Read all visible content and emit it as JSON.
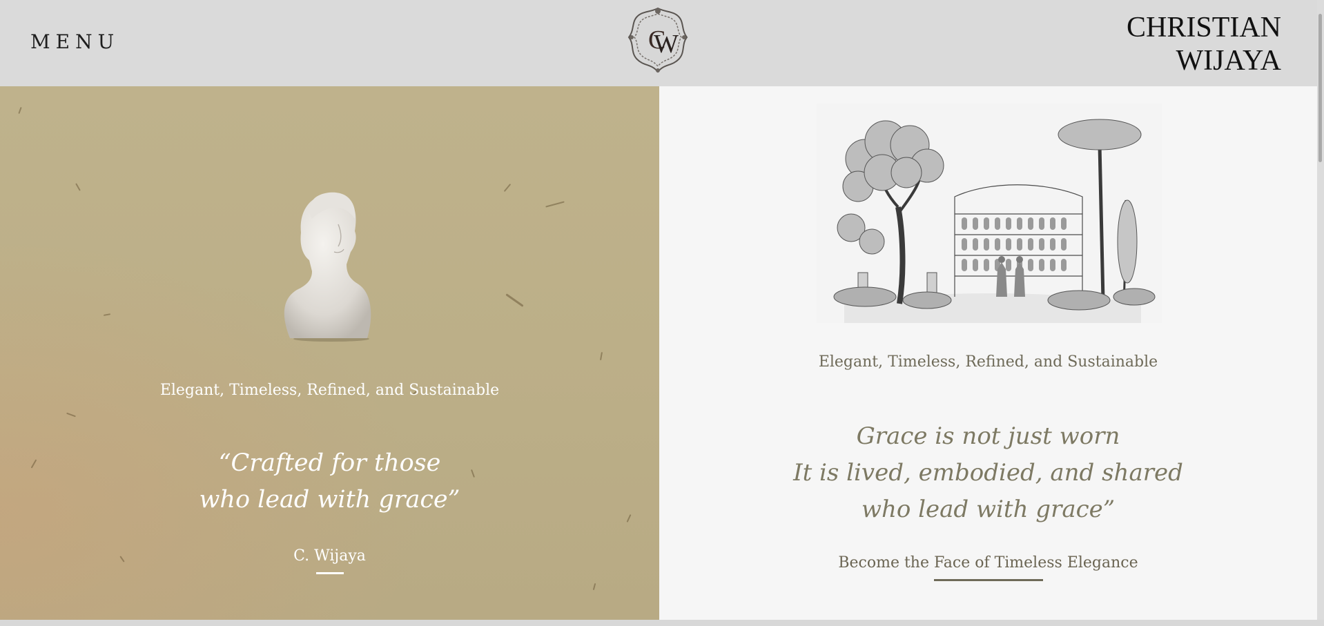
{
  "header": {
    "menu_label": "MENU",
    "logo_icon": "cw-monogram-crest-icon",
    "brand_line1": "CHRISTIAN",
    "brand_line2": "WIJAYA"
  },
  "left_panel": {
    "image": "marble-bust-image",
    "tagline": "Elegant, Timeless, Refined, and Sustainable",
    "quote_line1": "“Crafted for those",
    "quote_line2": "who lead with grace”",
    "signature": "C. Wijaya"
  },
  "right_panel": {
    "image": "colosseum-sketch-image",
    "tagline": "Elegant, Timeless, Refined, and Sustainable",
    "quote_line1": "Grace is not just worn",
    "quote_line2": "It is lived, embodied, and shared",
    "quote_line3": "who lead with grace”",
    "cta": "Become the Face of Timeless Elegance"
  },
  "colors": {
    "header_bg": "#dadada",
    "left_bg": "#bcaf88",
    "right_bg": "#f6f6f6",
    "right_text": "#7d7963"
  }
}
